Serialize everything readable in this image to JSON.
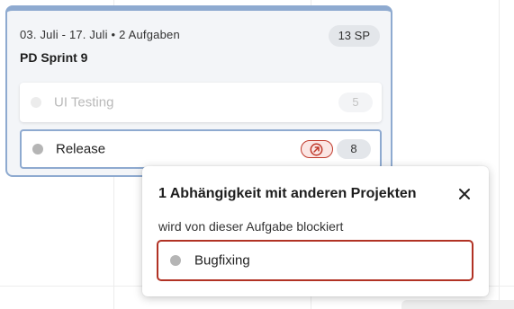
{
  "sprint": {
    "meta": "03. Juli - 17. Juli • 2 Aufgaben",
    "title": "PD Sprint 9",
    "story_points": "13 SP",
    "tasks": [
      {
        "label": "UI Testing",
        "points": "5",
        "state": "faded"
      },
      {
        "label": "Release",
        "points": "8",
        "state": "active",
        "has_dependency": true
      }
    ]
  },
  "popover": {
    "title": "1 Abhängigkeit mit anderen Projekten",
    "subtitle": "wird von dieser Aufgabe blockiert",
    "blocked_tasks": [
      {
        "label": "Bugfixing"
      }
    ]
  },
  "icons": {
    "dependency": "arrow-up-right-circle-icon",
    "close": "close-icon",
    "status": "status-dot-icon"
  },
  "colors": {
    "card_border": "#8eaad0",
    "dependency_red": "#c0392b",
    "blocked_border": "#b13224",
    "status_dot": "#b5b5b5"
  }
}
